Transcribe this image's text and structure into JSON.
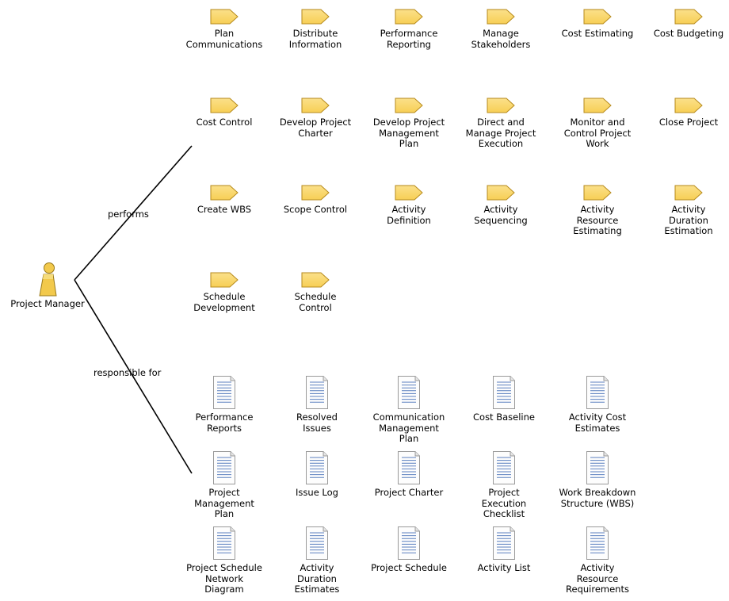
{
  "actor": {
    "label": "Project Manager",
    "icon": "person-icon"
  },
  "relations": {
    "performs": "performs",
    "responsible_for": "responsible for"
  },
  "colors": {
    "task_fill": "#f7cf55",
    "task_stroke": "#b68a1c",
    "actor_fill": "#f2c94c",
    "doc_line": "#5a7fbf"
  },
  "tasks": [
    "Plan\nCommunications",
    "Distribute\nInformation",
    "Performance\nReporting",
    "Manage\nStakeholders",
    "Cost Estimating",
    "Cost Budgeting",
    "Cost Control",
    "Develop Project\nCharter",
    "Develop Project\nManagement\nPlan",
    "Direct and\nManage Project\nExecution",
    "Monitor and\nControl Project\nWork",
    "Close Project",
    "Create WBS",
    "Scope Control",
    "Activity\nDefinition",
    "Activity\nSequencing",
    "Activity\nResource\nEstimating",
    "Activity\nDuration\nEstimation",
    "Schedule\nDevelopment",
    "Schedule\nControl"
  ],
  "documents": [
    "Performance\nReports",
    "Resolved\nIssues",
    "Communication\nManagement\nPlan",
    "Cost Baseline",
    "Activity Cost\nEstimates",
    "Project\nManagement\nPlan",
    "Issue Log",
    "Project Charter",
    "Project\nExecution\nChecklist",
    "Work Breakdown\nStructure (WBS)",
    "Project Schedule\nNetwork\nDiagram",
    "Activity\nDuration\nEstimates",
    "Project Schedule",
    "Activity List",
    "Activity\nResource\nRequirements"
  ]
}
